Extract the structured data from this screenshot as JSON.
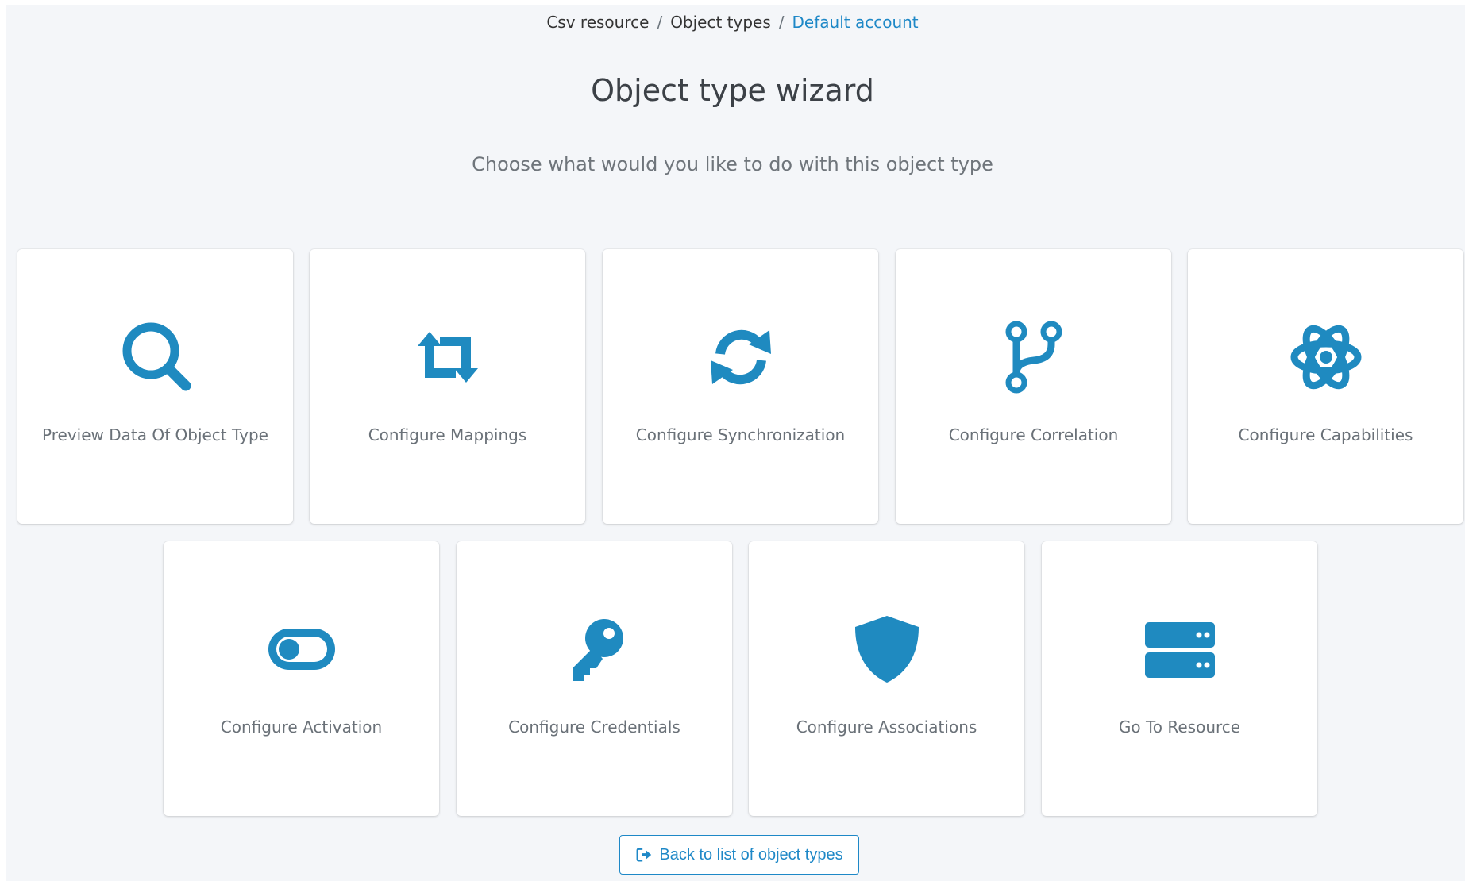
{
  "breadcrumb": {
    "items": [
      "Csv resource",
      "Object types",
      "Default account"
    ],
    "separator": "/"
  },
  "page": {
    "title": "Object type wizard",
    "subtitle": "Choose what would you like to do with this object type"
  },
  "cards": [
    {
      "label": "Preview Data Of Object Type",
      "icon": "search-icon"
    },
    {
      "label": "Configure Mappings",
      "icon": "retweet-icon"
    },
    {
      "label": "Configure Synchronization",
      "icon": "sync-icon"
    },
    {
      "label": "Configure Correlation",
      "icon": "code-branch-icon"
    },
    {
      "label": "Configure Capabilities",
      "icon": "atom-icon"
    },
    {
      "label": "Configure Activation",
      "icon": "toggle-icon"
    },
    {
      "label": "Configure Credentials",
      "icon": "key-icon"
    },
    {
      "label": "Configure Associations",
      "icon": "shield-icon"
    },
    {
      "label": "Go To Resource",
      "icon": "server-icon"
    }
  ],
  "back_button": {
    "label": "Back to list of object types",
    "icon": "sign-out-icon"
  },
  "colors": {
    "accent": "#1e88c7",
    "icon": "#1f8ac0",
    "page_background": "#f4f6f9",
    "card_background": "#ffffff",
    "label_text": "#6a7178"
  }
}
